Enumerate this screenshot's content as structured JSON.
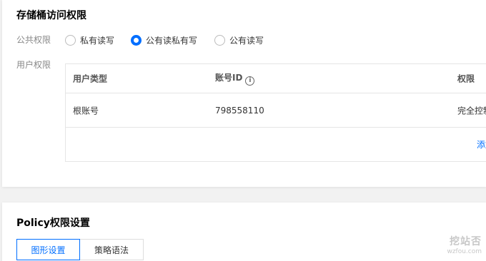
{
  "bucket_access": {
    "title": "存储桶访问权限",
    "public_label": "公共权限",
    "public_options": [
      {
        "label": "私有读写",
        "checked": false
      },
      {
        "label": "公有读私有写",
        "checked": true
      },
      {
        "label": "公有读写",
        "checked": false
      }
    ],
    "user_label": "用户权限",
    "table": {
      "headers": [
        "用户类型",
        "账号ID",
        "权限"
      ],
      "rows": [
        {
          "user_type": "根账号",
          "account_id": "798558110",
          "permission": "完全控制"
        }
      ],
      "add_label": "添加"
    }
  },
  "policy": {
    "title": "Policy权限设置",
    "tabs": [
      {
        "label": "图形设置",
        "active": true
      },
      {
        "label": "策略语法",
        "active": false
      }
    ]
  },
  "watermark": {
    "logo": "挖站否",
    "url": "wzfou.com"
  },
  "colors": {
    "accent": "#006eff",
    "border": "#e5e5e5"
  }
}
